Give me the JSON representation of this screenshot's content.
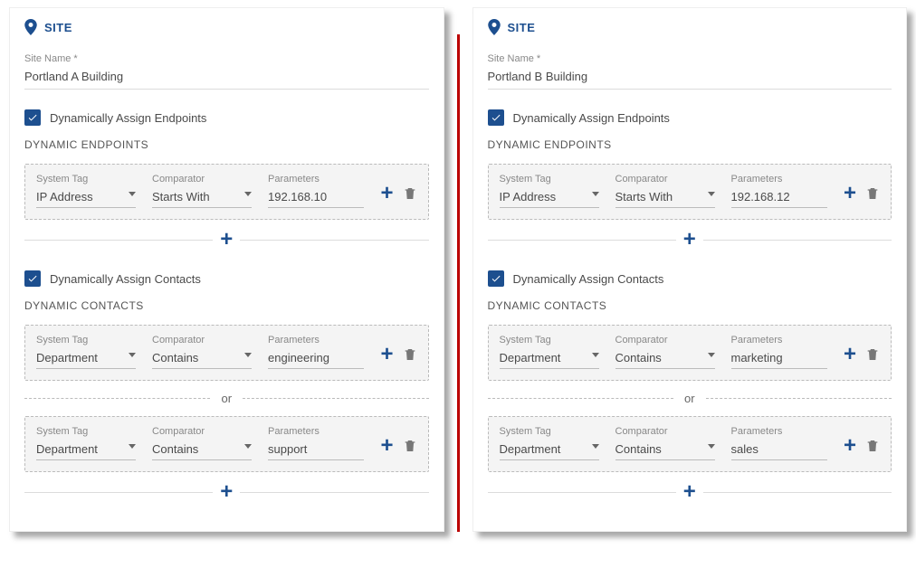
{
  "labels": {
    "site_header": "SITE",
    "site_name_label": "Site Name *",
    "dyn_endpoints_check": "Dynamically Assign Endpoints",
    "dyn_endpoints_title": "DYNAMIC ENDPOINTS",
    "dyn_contacts_check": "Dynamically Assign Contacts",
    "dyn_contacts_title": "DYNAMIC CONTACTS",
    "system_tag": "System Tag",
    "comparator": "Comparator",
    "parameters": "Parameters",
    "or": "or"
  },
  "left": {
    "site_name": "Portland A Building",
    "endpoints": [
      {
        "tag": "IP Address",
        "comparator": "Starts With",
        "param": "192.168.10"
      }
    ],
    "contacts": [
      {
        "tag": "Department",
        "comparator": "Contains",
        "param": "engineering"
      },
      {
        "tag": "Department",
        "comparator": "Contains",
        "param": "support"
      }
    ]
  },
  "right": {
    "site_name": "Portland B Building",
    "endpoints": [
      {
        "tag": "IP Address",
        "comparator": "Starts With",
        "param": "192.168.12"
      }
    ],
    "contacts": [
      {
        "tag": "Department",
        "comparator": "Contains",
        "param": "marketing"
      },
      {
        "tag": "Department",
        "comparator": "Contains",
        "param": "sales"
      }
    ]
  }
}
